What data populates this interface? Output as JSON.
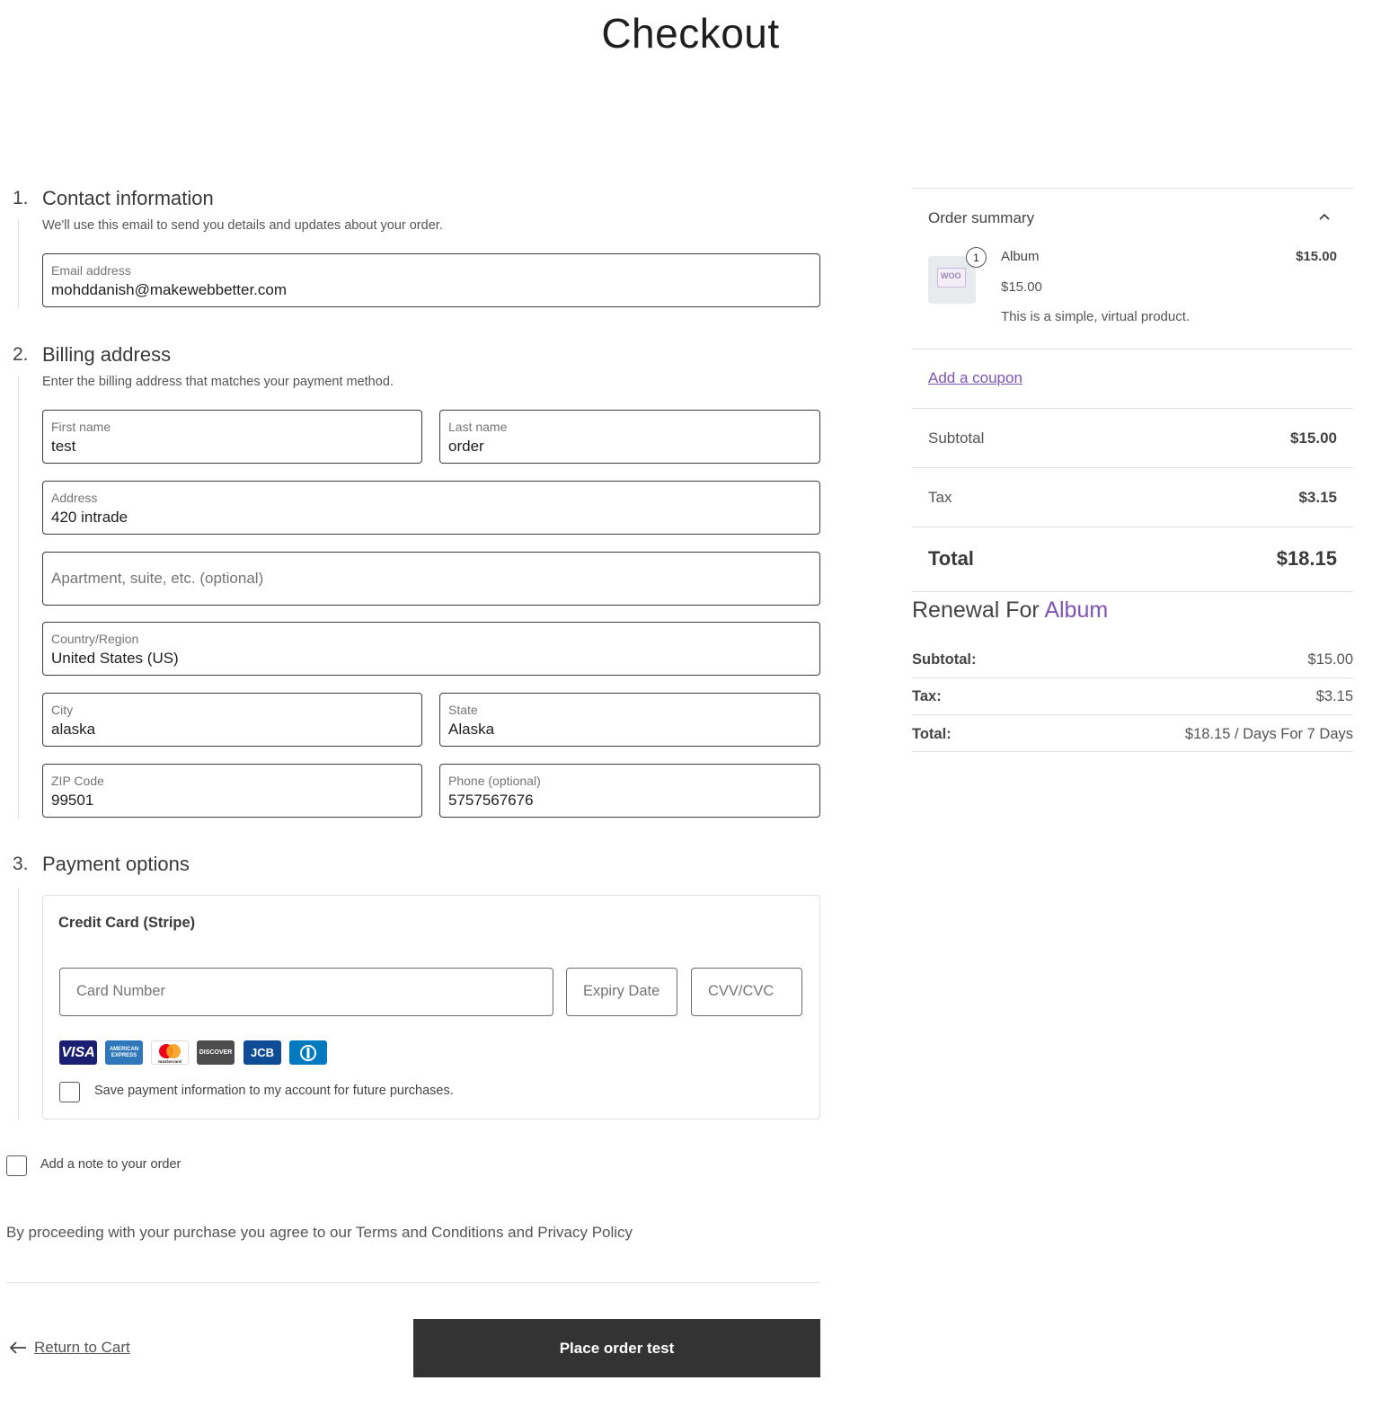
{
  "page": {
    "title": "Checkout"
  },
  "contact": {
    "step_number": "1.",
    "title": "Contact information",
    "description": "We'll use this email to send you details and updates about your order.",
    "email_label": "Email address",
    "email_value": "mohddanish@makewebbetter.com"
  },
  "billing": {
    "step_number": "2.",
    "title": "Billing address",
    "description": "Enter the billing address that matches your payment method.",
    "first_name_label": "First name",
    "first_name_value": "test",
    "last_name_label": "Last name",
    "last_name_value": "order",
    "address_label": "Address",
    "address_value": "420 intrade",
    "apartment_placeholder": "Apartment, suite, etc. (optional)",
    "country_label": "Country/Region",
    "country_value": "United States (US)",
    "city_label": "City",
    "city_value": "alaska",
    "state_label": "State",
    "state_value": "Alaska",
    "zip_label": "ZIP Code",
    "zip_value": "99501",
    "phone_label": "Phone (optional)",
    "phone_value": "5757567676"
  },
  "payment": {
    "step_number": "3.",
    "title": "Payment options",
    "method_title": "Credit Card (Stripe)",
    "card_number_placeholder": "Card Number",
    "expiry_placeholder": "Expiry Date",
    "cvc_placeholder": "CVV/CVC",
    "brands": [
      "VISA",
      "AMERICAN EXPRESS",
      "mastercard",
      "DISCOVER",
      "JCB",
      "Diners Club"
    ],
    "save_label": "Save payment information to my account for future purchases."
  },
  "order_note_label": "Add a note to your order",
  "terms_text": "By proceeding with your purchase you agree to our Terms and Conditions and Privacy Policy",
  "return_label": "Return to Cart",
  "place_order_label": "Place order test",
  "summary": {
    "title": "Order summary",
    "item": {
      "quantity": "1",
      "name": "Album",
      "line_total": "$15.00",
      "unit_price": "$15.00",
      "description": "This is a simple, virtual product.",
      "thumb_text": "WOO"
    },
    "coupon_label": "Add a coupon",
    "subtotal_label": "Subtotal",
    "subtotal_value": "$15.00",
    "tax_label": "Tax",
    "tax_value": "$3.15",
    "total_label": "Total",
    "total_value": "$18.15"
  },
  "renewal": {
    "title_prefix": "Renewal For",
    "title_product": "Album",
    "subtotal_label": "Subtotal:",
    "subtotal_value": "$15.00",
    "tax_label": "Tax:",
    "tax_value": "$3.15",
    "total_label": "Total:",
    "total_value": "$18.15 / Days For 7 Days"
  },
  "colors": {
    "accent": "#7f54b3",
    "button_bg": "#333333",
    "border": "#3c3c3c"
  }
}
